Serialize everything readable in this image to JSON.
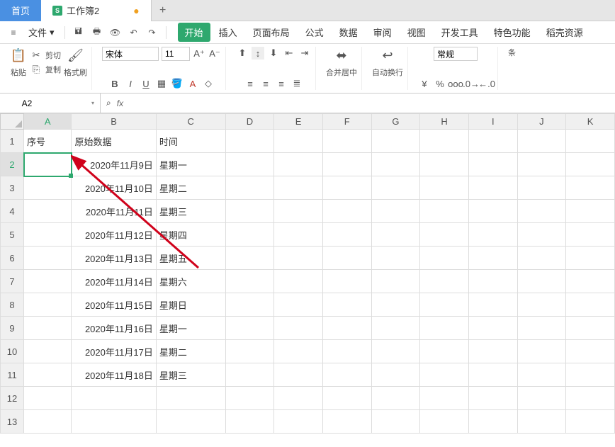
{
  "tabs": {
    "home": "首页",
    "doc_icon": "S",
    "doc_name": "工作簿2",
    "dot": "●",
    "add": "+"
  },
  "file_menu": "文件",
  "menu_tabs": {
    "start": "开始",
    "insert": "插入",
    "layout": "页面布局",
    "formula": "公式",
    "data": "数据",
    "review": "审阅",
    "view": "视图",
    "dev": "开发工具",
    "special": "特色功能",
    "resource": "稻壳资源"
  },
  "ribbon": {
    "paste": "粘贴",
    "cut": "剪切",
    "copy": "复制",
    "formatpainter": "格式刷",
    "font_name": "宋体",
    "font_size": "11",
    "merge": "合并居中",
    "wrap": "自动换行",
    "number_format": "常规",
    "conditions": "条"
  },
  "namebox": {
    "value": "A2"
  },
  "fx_label": "fx",
  "columns": [
    "A",
    "B",
    "C",
    "D",
    "E",
    "F",
    "G",
    "H",
    "I",
    "J",
    "K"
  ],
  "rows": [
    "1",
    "2",
    "3",
    "4",
    "5",
    "6",
    "7",
    "8",
    "9",
    "10",
    "11",
    "12",
    "13"
  ],
  "active_cell": {
    "row": 2,
    "col": "A"
  },
  "cells": {
    "header": {
      "A": "序号",
      "B": "原始数据",
      "C": "时间"
    },
    "data": [
      {
        "B": "2020年11月9日",
        "C": "星期一"
      },
      {
        "B": "2020年11月10日",
        "C": "星期二"
      },
      {
        "B": "2020年11月11日",
        "C": "星期三"
      },
      {
        "B": "2020年11月12日",
        "C": "星期四"
      },
      {
        "B": "2020年11月13日",
        "C": "星期五"
      },
      {
        "B": "2020年11月14日",
        "C": "星期六"
      },
      {
        "B": "2020年11月15日",
        "C": "星期日"
      },
      {
        "B": "2020年11月16日",
        "C": "星期一"
      },
      {
        "B": "2020年11月17日",
        "C": "星期二"
      },
      {
        "B": "2020年11月18日",
        "C": "星期三"
      }
    ]
  }
}
